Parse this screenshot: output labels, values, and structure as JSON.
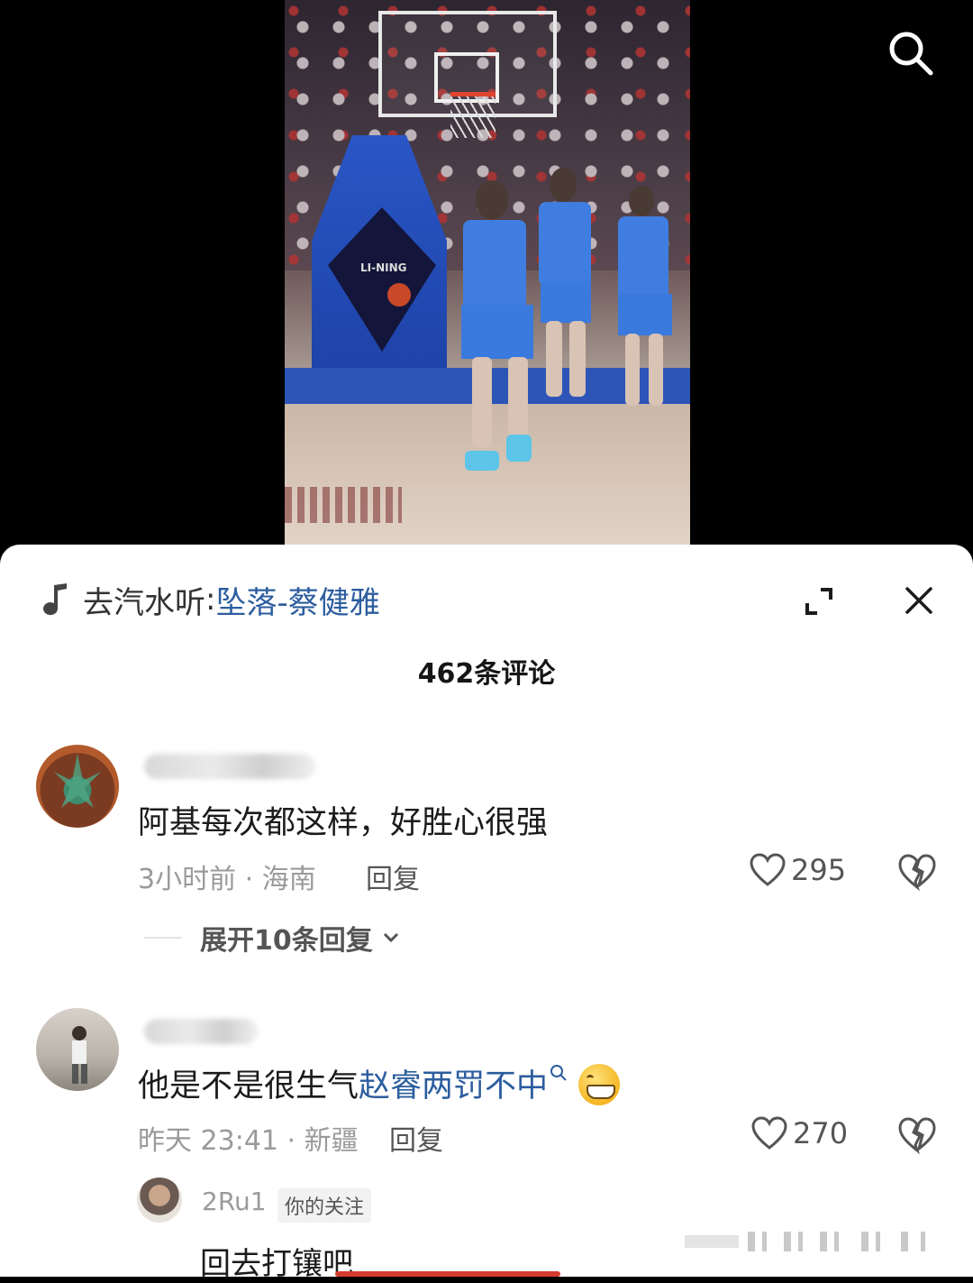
{
  "music": {
    "prefix": "去汽水听",
    "separator": ":",
    "song": "坠落-蔡健雅"
  },
  "comments_header": {
    "count_label": "462条评论"
  },
  "comments": [
    {
      "text": "阿基每次都这样，好胜心很强",
      "meta": "3小时前 · 海南",
      "reply_label": "回复",
      "likes": "295",
      "expand_label": "展开10条回复"
    },
    {
      "text_before": "他是不是很生气",
      "keyword": "赵睿两罚不中",
      "meta": "昨天 23:41 · 新疆",
      "reply_label": "回复",
      "likes": "270",
      "reply": {
        "username": "2Ru1",
        "tag": "你的关注",
        "text": "回去打镶吧"
      }
    }
  ],
  "video": {
    "stanchion_logo": "LI-NING"
  },
  "icons": {
    "search": "search-icon",
    "music": "music-note-icon",
    "expand": "expand-icon",
    "close": "close-icon",
    "like": "heart-icon",
    "dislike": "broken-heart-icon",
    "chevron": "chevron-down-icon"
  },
  "colors": {
    "link_blue": "#2c5d9e",
    "meta_gray": "#9a9a9a",
    "accent_red": "#d63b2f"
  }
}
